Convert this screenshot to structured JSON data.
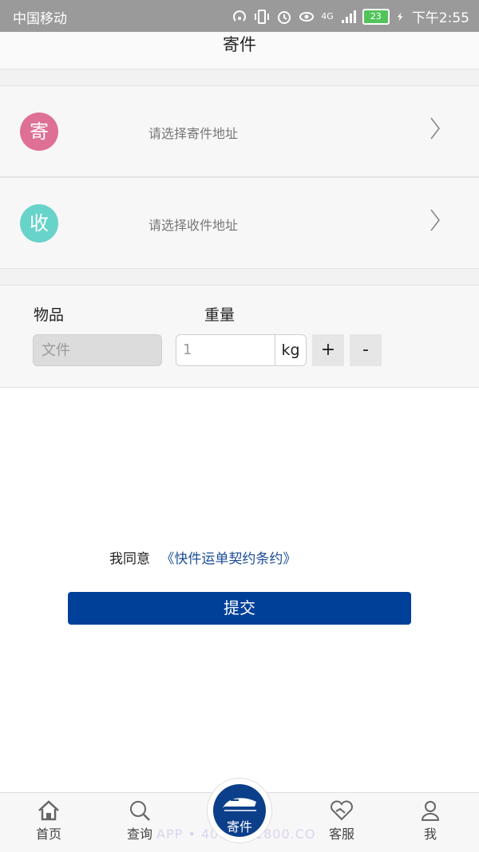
{
  "status_bar": {
    "carrier": "中国移动",
    "network": "4G",
    "battery": "23",
    "time": "下午2:55"
  },
  "header": {
    "title": "寄件"
  },
  "sender": {
    "badge": "寄",
    "hint": "请选择寄件地址",
    "badge_color": "#de6f95"
  },
  "receiver": {
    "badge": "收",
    "hint": "请选择收件地址",
    "badge_color": "#68d3c9"
  },
  "goods": {
    "item_label": "物品",
    "item_placeholder": "文件",
    "weight_label": "重量",
    "weight_placeholder": "1",
    "unit": "kg",
    "plus": "+",
    "minus": "-"
  },
  "agreement": {
    "prefix": "我同意",
    "link": "《快件运单契约条约》"
  },
  "submit_label": "提交",
  "tabbar": {
    "home": "首页",
    "query": "查询",
    "send": "寄件",
    "service": "客服",
    "me": "我"
  },
  "watermark": "APP • 4008951800.CO",
  "colors": {
    "primary": "#004098",
    "link": "#1c4d97"
  }
}
